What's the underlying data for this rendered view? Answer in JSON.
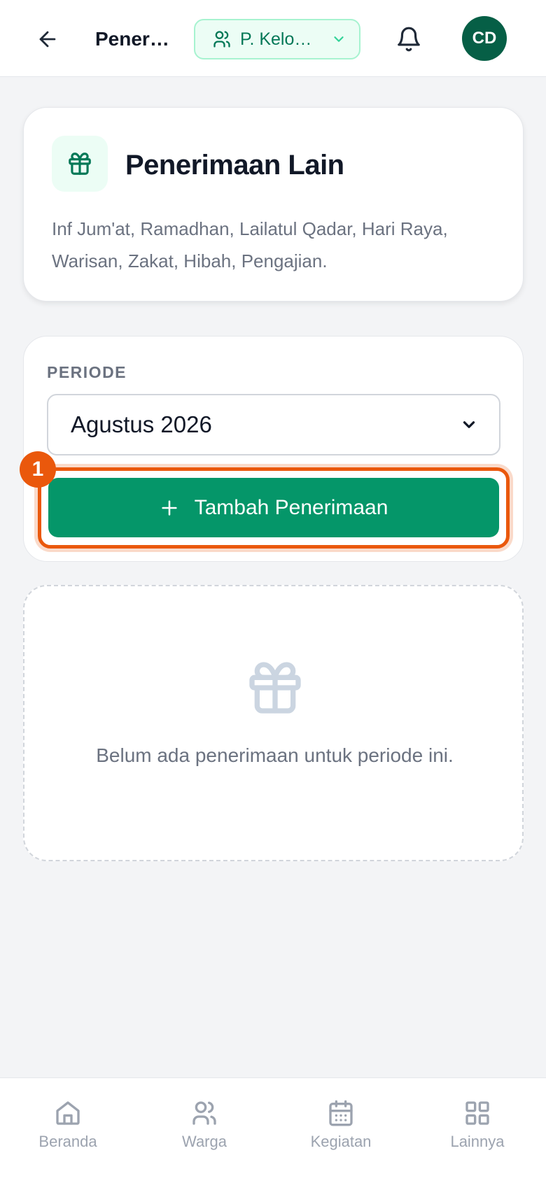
{
  "header": {
    "title": "Penerimaan Lain",
    "group_selector": "P. Kelompok",
    "avatar_initials": "CD"
  },
  "info_card": {
    "title": "Penerimaan Lain",
    "description": "Inf Jum'at, Ramadhan, Lailatul Qadar, Hari Raya, Warisan, Zakat, Hibah, Pengajian.",
    "icon": "gift-icon"
  },
  "period": {
    "label": "PERIODE",
    "selected": "Agustus 2026"
  },
  "add_button": {
    "label": "Tambah Penerimaan",
    "step_badge": "1"
  },
  "empty_state": {
    "icon": "gift-icon",
    "message": "Belum ada penerimaan untuk periode ini."
  },
  "bottom_nav": {
    "items": [
      {
        "label": "Beranda",
        "icon": "home-icon"
      },
      {
        "label": "Warga",
        "icon": "users-icon"
      },
      {
        "label": "Kegiatan",
        "icon": "calendar-icon"
      },
      {
        "label": "Lainnya",
        "icon": "grid-icon"
      }
    ]
  },
  "colors": {
    "primary": "#059669",
    "highlight": "#ea580c",
    "avatar": "#065f46"
  }
}
